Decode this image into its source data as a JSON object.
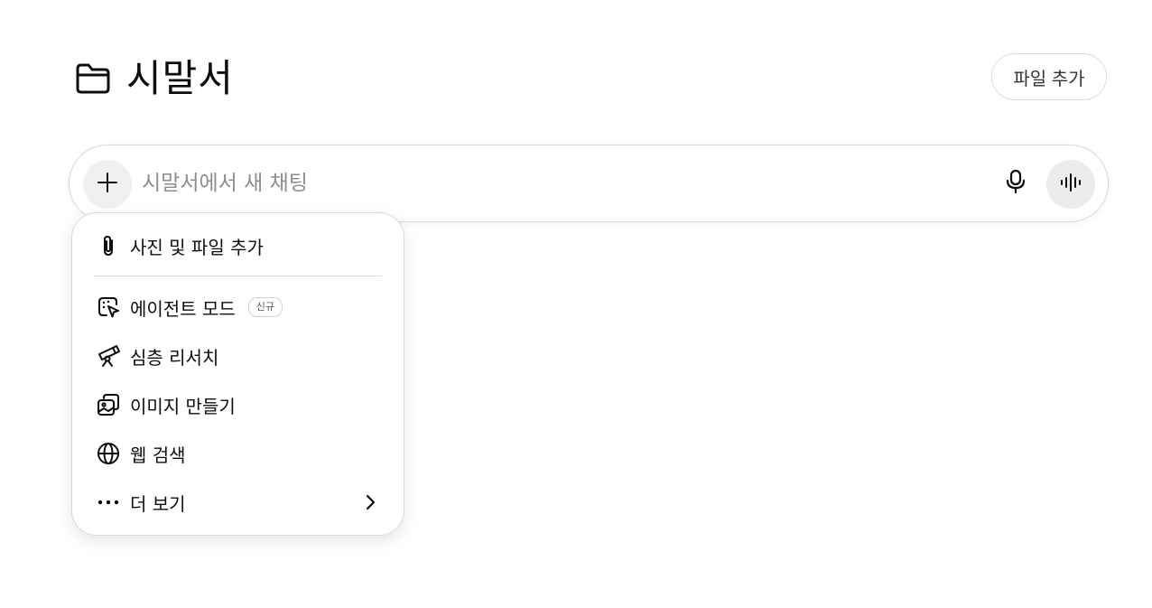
{
  "header": {
    "title": "시말서",
    "folder_icon": "folder-icon",
    "add_files_label": "파일 추가"
  },
  "composer": {
    "placeholder": "시말서에서 새 채팅",
    "value": "",
    "plus_icon": "plus-icon",
    "mic_icon": "microphone-icon",
    "voice_icon": "voice-waveform-icon"
  },
  "menu": {
    "items": [
      {
        "label": "사진 및 파일 추가",
        "icon": "paperclip-icon"
      },
      {
        "label": "에이전트 모드",
        "icon": "agent-cursor-icon",
        "badge": "신규"
      },
      {
        "label": "심층 리서치",
        "icon": "telescope-icon"
      },
      {
        "label": "이미지 만들기",
        "icon": "image-create-icon"
      },
      {
        "label": "웹 검색",
        "icon": "globe-icon"
      },
      {
        "label": "더 보기",
        "icon": "more-dots-icon",
        "chevron": "chevron-right-icon"
      }
    ]
  }
}
